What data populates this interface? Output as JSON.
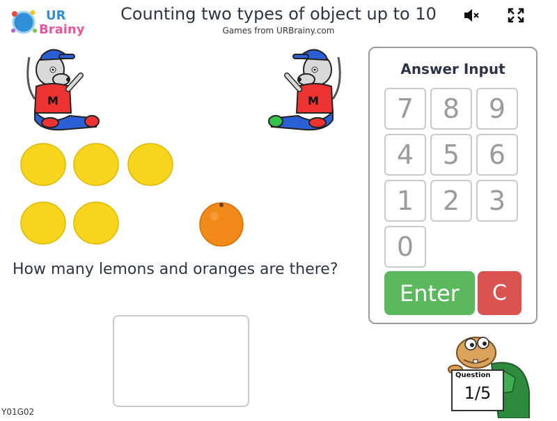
{
  "header": {
    "logo_text_line1": "UR",
    "logo_text_line2": "Brainy",
    "title": "Counting two types of object up to 10",
    "subtitle": "Games from URBrainy.com",
    "mute_icon": "speaker-mute-icon",
    "fullscreen_icon": "fullscreen-icon"
  },
  "question": {
    "text": "How many lemons and oranges are there?",
    "lemons": 5,
    "oranges": 1
  },
  "answer": {
    "value": ""
  },
  "keypad": {
    "title": "Answer Input",
    "keys": [
      "7",
      "8",
      "9",
      "4",
      "5",
      "6",
      "1",
      "2",
      "3",
      "0"
    ],
    "enter_label": "Enter",
    "clear_label": "C"
  },
  "progress": {
    "label": "Question",
    "count": "1/5"
  },
  "footer": {
    "code": "Y01G02"
  },
  "colors": {
    "lemon": "#f7d51d",
    "orange": "#f28a1a",
    "enter": "#5cb85c",
    "clear": "#d9534f"
  }
}
